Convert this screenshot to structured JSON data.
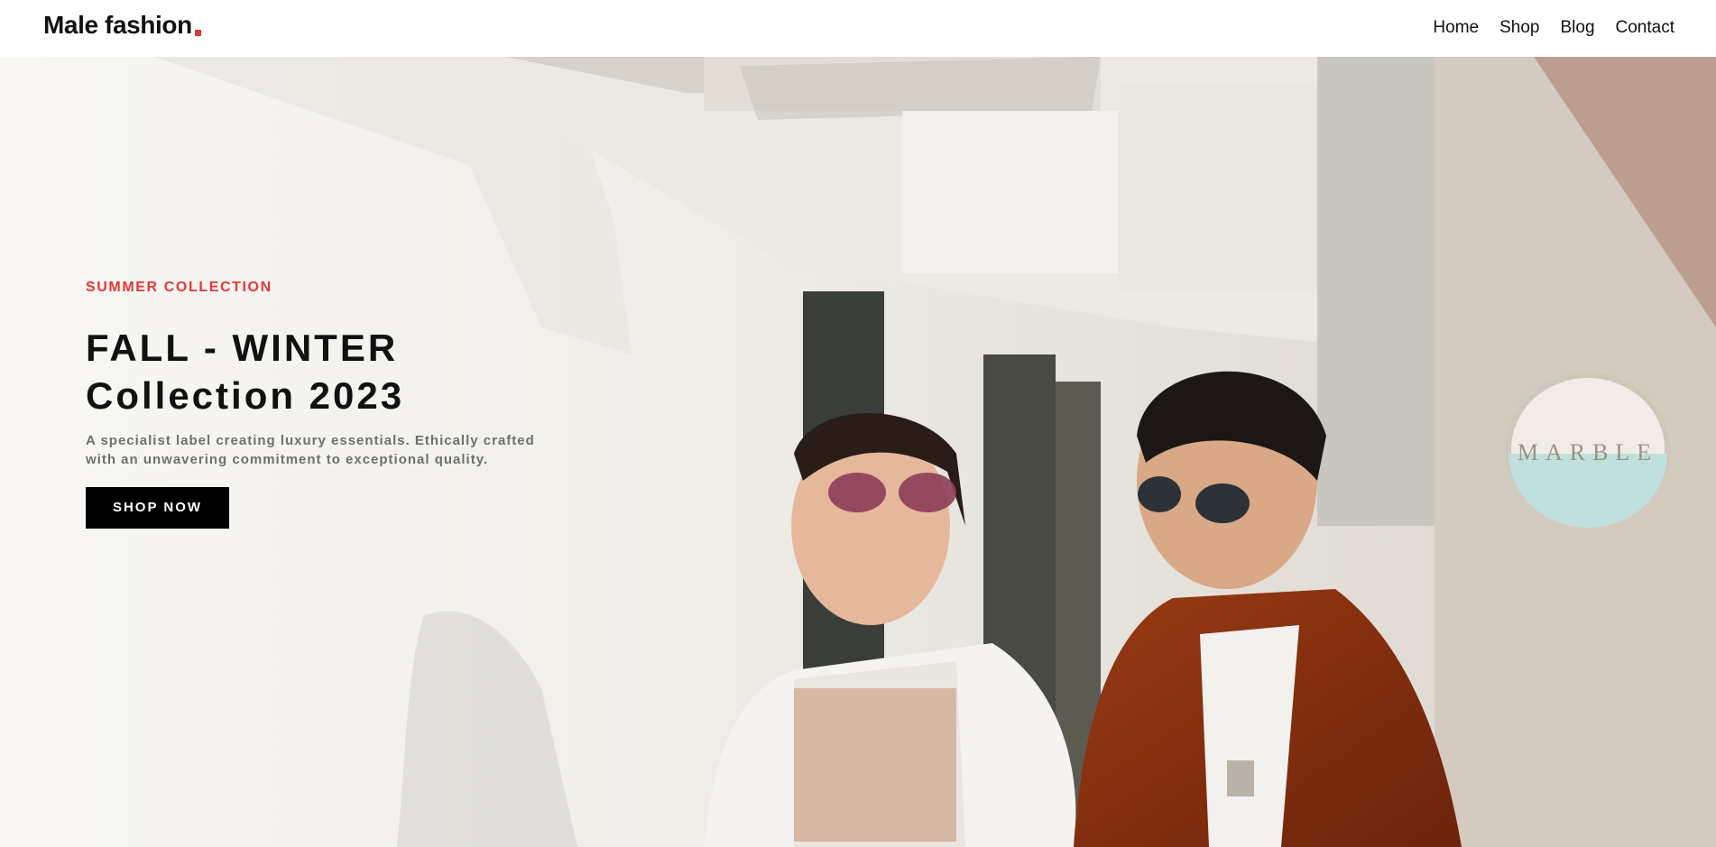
{
  "header": {
    "logo": "Male fashion",
    "logo_accent_color": "#e53637",
    "nav": [
      "Home",
      "Shop",
      "Blog",
      "Contact"
    ]
  },
  "hero": {
    "eyebrow": "SUMMER COLLECTION",
    "headline_line1": "FALL - WINTER",
    "headline_line2": "Collection 2023",
    "subtext_line1": "A specialist label creating luxury essentials. Ethically crafted",
    "subtext_line2": "with an unwavering commitment to exceptional quality.",
    "button": "SHOP NOW",
    "sign_text": "MARBLE",
    "accent_color": "#e53637"
  }
}
